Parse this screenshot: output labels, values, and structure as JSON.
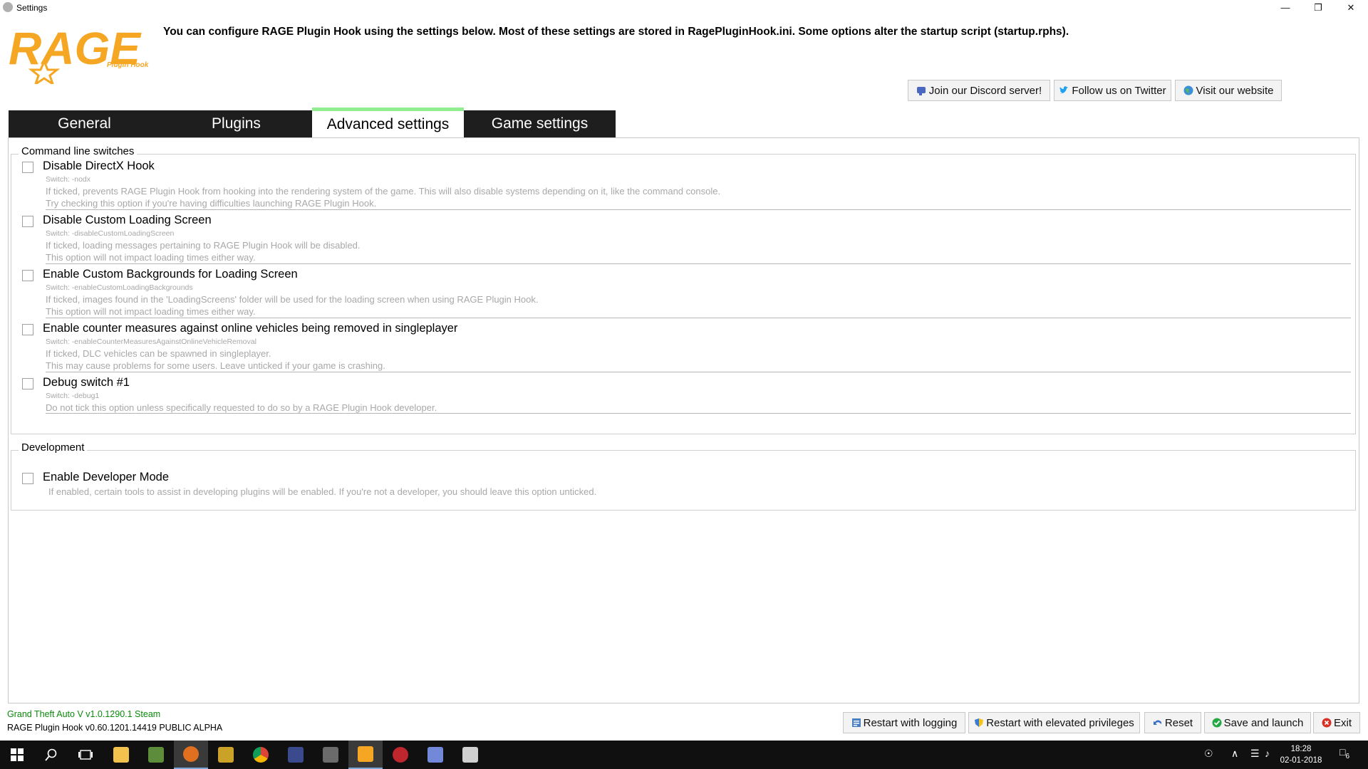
{
  "window": {
    "title": "Settings",
    "minimize_glyph": "—",
    "restore_glyph": "❐",
    "close_glyph": "✕"
  },
  "header": {
    "logo_text": "RAGE",
    "logo_sub": "Plugin Hook",
    "description": "You can configure RAGE Plugin Hook using the settings below. Most of these settings are stored in RagePluginHook.ini. Some options alter the startup script (startup.rphs).",
    "links": [
      {
        "label": "Join our Discord server!",
        "icon": "discord-icon"
      },
      {
        "label": "Follow us on Twitter",
        "icon": "twitter-icon"
      },
      {
        "label": "Visit our website",
        "icon": "globe-icon"
      }
    ]
  },
  "tabs": [
    {
      "label": "General",
      "active": false
    },
    {
      "label": "Plugins",
      "active": false
    },
    {
      "label": "Advanced settings",
      "active": true
    },
    {
      "label": "Game settings",
      "active": false
    }
  ],
  "command_line": {
    "title": "Command line switches",
    "options": [
      {
        "label": "Disable DirectX Hook",
        "switch": "Switch: -nodx",
        "desc1": "If ticked, prevents RAGE Plugin Hook from hooking into the rendering system of the game. This will also disable systems depending on it, like the command console.",
        "desc2": "Try checking this option if you're having difficulties launching RAGE Plugin Hook.",
        "checked": false
      },
      {
        "label": "Disable Custom Loading Screen",
        "switch": "Switch: -disableCustomLoadingScreen",
        "desc1": "If ticked, loading messages pertaining to RAGE Plugin Hook will be disabled.",
        "desc2": "This option will not impact loading times either way.",
        "checked": false
      },
      {
        "label": "Enable Custom Backgrounds for Loading Screen",
        "switch": "Switch: -enableCustomLoadingBackgrounds",
        "desc1": "If ticked, images found in the 'LoadingScreens' folder will be used for the loading screen when using RAGE Plugin Hook.",
        "desc2": "This option will not impact loading times either way.",
        "checked": false
      },
      {
        "label": "Enable counter measures against online vehicles being removed in singleplayer",
        "switch": "Switch: -enableCounterMeasuresAgainstOnlineVehicleRemoval",
        "desc1": "If ticked, DLC vehicles can be spawned in singleplayer.",
        "desc2": "This may cause problems for some users. Leave unticked if your game is crashing.",
        "checked": false
      },
      {
        "label": "Debug switch #1",
        "switch": "Switch: -debug1",
        "desc1": "Do not tick this option unless specifically requested to do so by a RAGE Plugin Hook developer.",
        "desc2": "",
        "checked": false
      }
    ]
  },
  "development": {
    "title": "Development",
    "option": {
      "label": "Enable Developer Mode",
      "desc": "If enabled, certain tools to assist in developing plugins will be enabled. If you're not a developer, you should leave this option unticked.",
      "checked": false
    }
  },
  "footer": {
    "game_version": "Grand Theft Auto V v1.0.1290.1 Steam",
    "rph_version": "RAGE Plugin Hook v0.60.1201.14419 PUBLIC ALPHA",
    "buttons": [
      {
        "label": "Restart with logging",
        "icon": "log-icon"
      },
      {
        "label": "Restart with elevated privileges",
        "icon": "shield-icon"
      },
      {
        "label": "Reset",
        "icon": "undo-icon"
      },
      {
        "label": "Save and launch",
        "icon": "check-icon"
      },
      {
        "label": "Exit",
        "icon": "error-icon"
      }
    ]
  },
  "taskbar": {
    "time": "18:28",
    "date": "02-01-2018",
    "notification_count": "6",
    "apps": [
      "start-icon",
      "search-icon",
      "task-view-icon",
      "file-explorer-icon",
      "minecraft-icon",
      "steam-icon",
      "pubg-icon",
      "chrome-icon",
      "app-icon",
      "world-of-tanks-icon",
      "rage-plugin-hook-icon",
      "game-icon",
      "discord-icon",
      "calculator-icon"
    ]
  },
  "colors": {
    "accent_green": "#90ee90",
    "logo_orange": "#f5a623",
    "tab_dark": "#1e1e1e",
    "version_green": "#0a8a0a"
  }
}
